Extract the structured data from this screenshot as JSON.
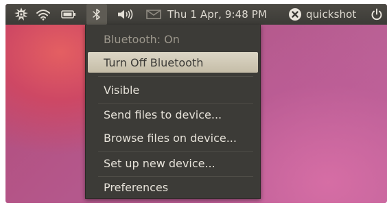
{
  "topbar": {
    "clock": "Thu  1 Apr,  9:48 PM",
    "username": "quickshot",
    "icons": [
      "network-activity-icon",
      "wifi-icon",
      "battery-icon",
      "bluetooth-icon",
      "volume-icon",
      "mail-icon",
      "user-status-icon",
      "power-icon"
    ]
  },
  "menu": {
    "status": "Bluetooth: On",
    "items": [
      "Turn Off Bluetooth",
      "Visible",
      "Send files to device...",
      "Browse files on device...",
      "Set up new device...",
      "Preferences"
    ]
  },
  "colors": {
    "panel": "#3c3b37",
    "highlight": "#d6cfbd",
    "text": "#e6e2d9"
  }
}
